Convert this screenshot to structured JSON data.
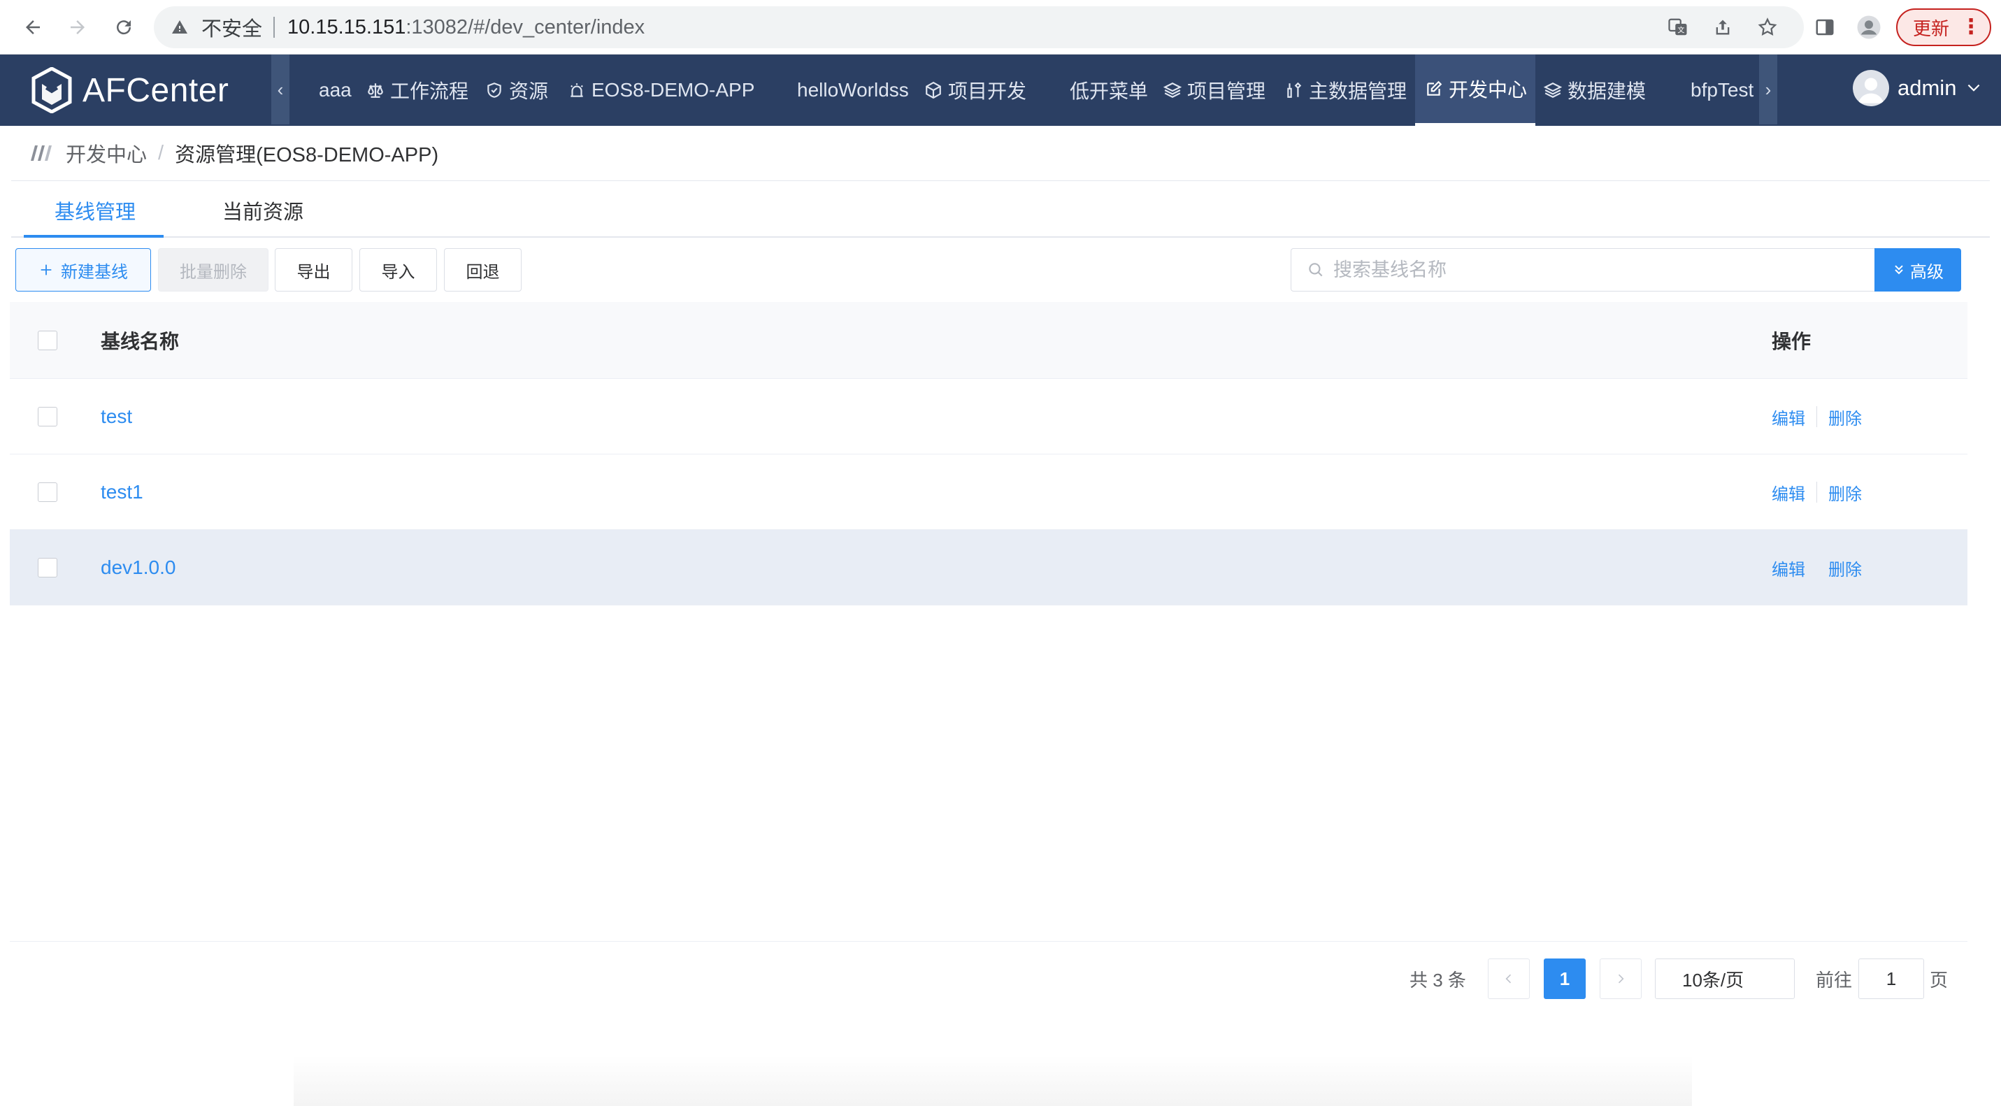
{
  "browser": {
    "insecure_label": "不安全",
    "url_host": "10.15.15.151",
    "url_rest": ":13082/#/dev_center/index",
    "update_label": "更新"
  },
  "app": {
    "logo_text": "AFCenter",
    "menu": [
      {
        "label": "aaa",
        "icon": "none"
      },
      {
        "label": "工作流程",
        "icon": "scale-icon"
      },
      {
        "label": "资源",
        "icon": "shield-icon"
      },
      {
        "label": "EOS8-DEMO-APP",
        "icon": "alarm-icon"
      },
      {
        "label": "helloWorldss",
        "icon": "none"
      },
      {
        "label": "项目开发",
        "icon": "cube-icon"
      },
      {
        "label": "低开菜单",
        "icon": "none"
      },
      {
        "label": "项目管理",
        "icon": "layers-icon"
      },
      {
        "label": "主数据管理",
        "icon": "tools-icon"
      },
      {
        "label": "开发中心",
        "icon": "edit-icon",
        "active": true
      },
      {
        "label": "数据建模",
        "icon": "layers-icon"
      },
      {
        "label": "bfpTest",
        "icon": "none"
      }
    ],
    "user": "admin"
  },
  "breadcrumb": {
    "parent": "开发中心",
    "separator": "/",
    "current": "资源管理(EOS8-DEMO-APP)"
  },
  "tabs": [
    {
      "label": "基线管理",
      "active": true
    },
    {
      "label": "当前资源",
      "active": false
    }
  ],
  "toolbar": {
    "new_label": "新建基线",
    "batch_delete_label": "批量删除",
    "export_label": "导出",
    "import_label": "导入",
    "rollback_label": "回退",
    "search_placeholder": "搜索基线名称",
    "advanced_label": "高级"
  },
  "table": {
    "columns": {
      "name": "基线名称",
      "ops": "操作"
    },
    "rows": [
      {
        "name": "test",
        "edit": "编辑",
        "delete": "删除"
      },
      {
        "name": "test1",
        "edit": "编辑",
        "delete": "删除"
      },
      {
        "name": "dev1.0.0",
        "edit": "编辑",
        "delete": "删除"
      }
    ]
  },
  "pagination": {
    "total_text": "共 3 条",
    "current_page": "1",
    "page_size": "10条/页",
    "goto_prefix": "前往",
    "goto_value": "1",
    "goto_suffix": "页"
  },
  "colors": {
    "header_bg": "#2b3f63",
    "accent": "#2d8cf0",
    "hover_row": "#e8edf5"
  }
}
